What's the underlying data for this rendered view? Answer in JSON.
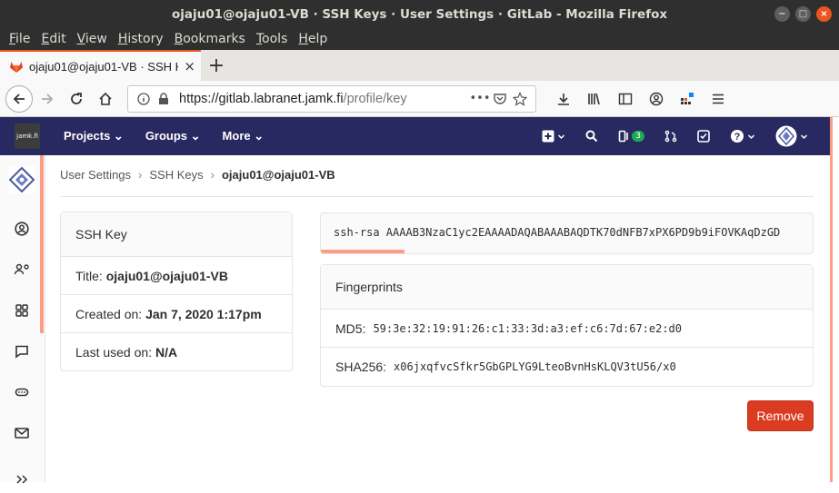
{
  "window": {
    "title": "ojaju01@ojaju01-VB · SSH Keys · User Settings · GitLab - Mozilla Firefox",
    "controls": [
      "−",
      "□",
      "×"
    ]
  },
  "menubar": [
    "File",
    "Edit",
    "View",
    "History",
    "Bookmarks",
    "Tools",
    "Help"
  ],
  "tab": {
    "title": "ojaju01@ojaju01-VB · SSH Key",
    "close": "×",
    "new_tab": "+"
  },
  "address": {
    "host": "https://gitlab.labranet.jamk.fi",
    "path": "/profile/key",
    "menu": "•••"
  },
  "gitlab": {
    "logo_text": "jamk.fi",
    "nav": [
      "Projects ⌄",
      "Groups ⌄",
      "More ⌄"
    ],
    "mr_count": "3"
  },
  "breadcrumb": {
    "items": [
      "User Settings",
      "SSH Keys"
    ],
    "current": "ojaju01@ojaju01-VB",
    "separator": "›"
  },
  "ssh_key_card": {
    "heading": "SSH Key",
    "title_label": "Title:",
    "title_value": "ojaju01@ojaju01-VB",
    "created_label": "Created on:",
    "created_value": "Jan 7, 2020 1:17pm",
    "last_used_label": "Last used on:",
    "last_used_value": "N/A"
  },
  "key_text": "ssh-rsa AAAAB3NzaC1yc2EAAAADAQABAAABAQDTK70dNFB7xPX6PD9b9iFOVKAqDzGD",
  "fingerprints": {
    "heading": "Fingerprints",
    "md5_label": "MD5:",
    "md5_value": "59:3e:32:19:91:26:c1:33:3d:a3:ef:c6:7d:67:e2:d0",
    "sha256_label": "SHA256:",
    "sha256_value": "x06jxqfvcSfkr5GbGPLYG9LteoBvnHsKLQV3tU56/x0"
  },
  "remove_button": "Remove",
  "colors": {
    "header": "#292961",
    "accent": "#fc9e86",
    "danger": "#db3b21",
    "ubuntu_orange": "#e95420"
  }
}
